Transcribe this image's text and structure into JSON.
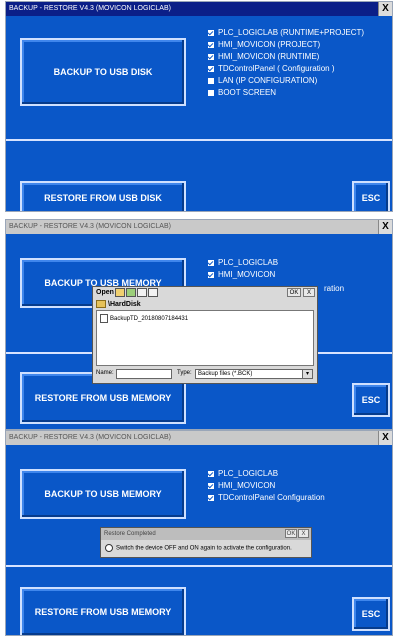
{
  "panel1": {
    "title": "BACKUP - RESTORE V4.3 (MOVICON LOGICLAB)",
    "close": "X",
    "backup_label": "BACKUP TO USB DISK",
    "restore_label": "RESTORE FROM USB DISK",
    "esc_label": "ESC",
    "options": [
      {
        "label": "PLC_LOGICLAB (RUNTIME+PROJECT)",
        "checked": true
      },
      {
        "label": "HMI_MOVICON (PROJECT)",
        "checked": true
      },
      {
        "label": "HMI_MOVICON (RUNTIME)",
        "checked": true
      },
      {
        "label": "TDControlPanel ( Configuration )",
        "checked": true
      },
      {
        "label": "LAN (IP CONFIGURATION)",
        "checked": false
      },
      {
        "label": "BOOT SCREEN",
        "checked": false
      }
    ]
  },
  "panel2": {
    "title": "BACKUP - RESTORE V4.3 (MOVICON LOGICLAB)",
    "close": "X",
    "backup_label": "BACKUP TO USB MEMORY",
    "restore_label": "RESTORE FROM USB MEMORY",
    "esc_label": "ESC",
    "options": [
      {
        "label": "PLC_LOGICLAB",
        "checked": true
      },
      {
        "label": "HMI_MOVICON",
        "checked": true
      }
    ],
    "partial_text": "ration",
    "open_dialog": {
      "title": "Open",
      "ok": "OK",
      "close": "X",
      "folder": "\\HardDisk",
      "file": "BackupTD_20180807184431",
      "name_label": "Name:",
      "name_value": "",
      "type_label": "Type:",
      "type_value": "Backup files (*.BCK)"
    }
  },
  "panel3": {
    "title": "BACKUP - RESTORE V4.3 (MOVICON LOGICLAB)",
    "close": "X",
    "backup_label": "BACKUP TO USB MEMORY",
    "restore_label": "RESTORE FROM USB MEMORY",
    "esc_label": "ESC",
    "options": [
      {
        "label": "PLC_LOGICLAB",
        "checked": true
      },
      {
        "label": "HMI_MOVICON",
        "checked": true
      },
      {
        "label": "TDControlPanel Configuration",
        "checked": true
      }
    ],
    "message_dialog": {
      "title": "Restore Completed",
      "ok": "OK",
      "close": "X",
      "message": "Switch the device OFF and ON again to activate the configuration."
    }
  },
  "colors": {
    "panel_blue": "#0a57c8",
    "titlebar_active": "#0b1f88",
    "titlebar_inactive": "#c9c9c9"
  }
}
